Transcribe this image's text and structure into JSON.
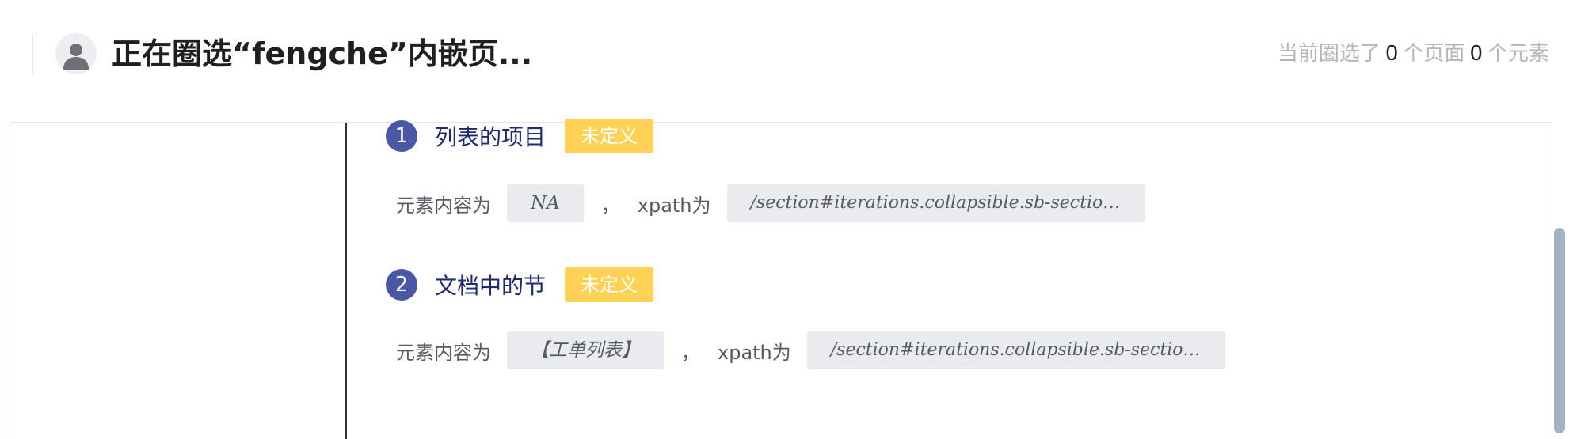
{
  "header": {
    "title": "正在圈选“fengche”内嵌页...",
    "summary_prefix": "当前圈选了",
    "page_count": "0",
    "page_unit": "个页面",
    "element_count": "0",
    "element_unit": "个元素"
  },
  "items": [
    {
      "number": "1",
      "title": "列表的项目",
      "status": "未定义",
      "content_label": "元素内容为",
      "content_value": "NA",
      "separator": "，",
      "xpath_label": "xpath为",
      "xpath_value": "/section#iterations.collapsible.sb-section/di···"
    },
    {
      "number": "2",
      "title": "文档中的节",
      "status": "未定义",
      "content_label": "元素内容为",
      "content_value": "【工单列表】",
      "separator": "，",
      "xpath_label": "xpath为",
      "xpath_value": "/section#iterations.collapsible.sb-section/di···"
    }
  ],
  "icons": {
    "avatar": "user-avatar-icon"
  },
  "colors": {
    "accent": "#4a57a5",
    "badge": "#ffd255",
    "item_title": "#1d2b70",
    "muted": "#b3b6bd"
  }
}
